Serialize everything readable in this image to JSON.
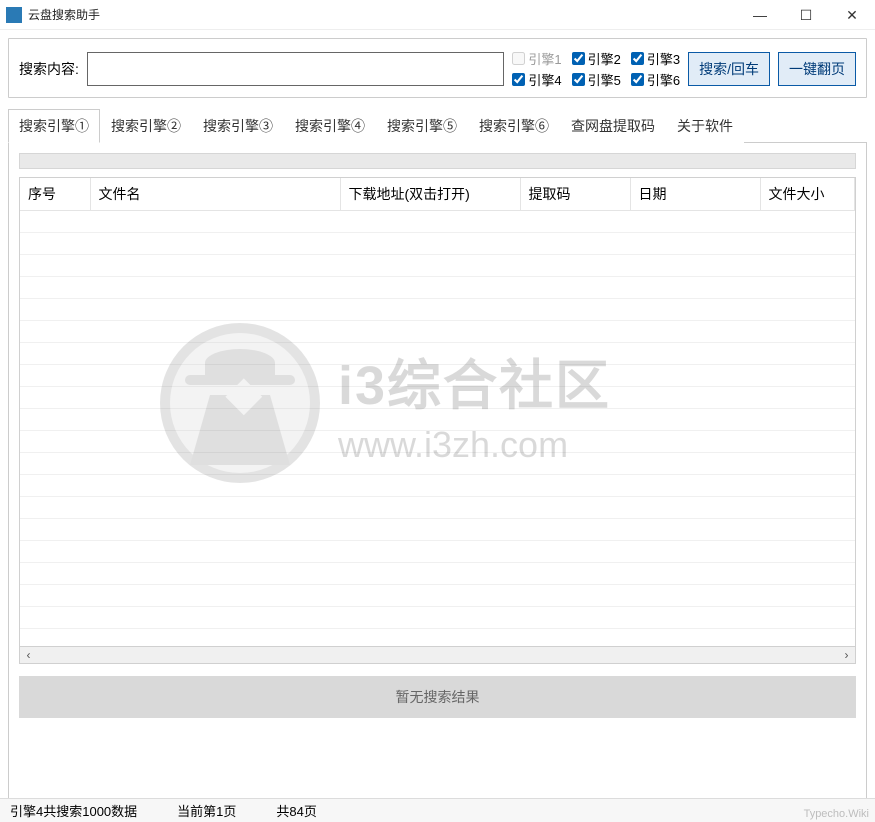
{
  "window": {
    "title": "云盘搜索助手"
  },
  "search": {
    "label": "搜索内容:",
    "value": "",
    "placeholder": ""
  },
  "engines": [
    {
      "label": "引擎1",
      "checked": false,
      "disabled": true
    },
    {
      "label": "引擎2",
      "checked": true,
      "disabled": false
    },
    {
      "label": "引擎3",
      "checked": true,
      "disabled": false
    },
    {
      "label": "引擎4",
      "checked": true,
      "disabled": false
    },
    {
      "label": "引擎5",
      "checked": true,
      "disabled": false
    },
    {
      "label": "引擎6",
      "checked": true,
      "disabled": false
    }
  ],
  "buttons": {
    "search": "搜索/回车",
    "page_flip": "一键翻页"
  },
  "tabs": [
    "搜索引擎①",
    "搜索引擎②",
    "搜索引擎③",
    "搜索引擎④",
    "搜索引擎⑤",
    "搜索引擎⑥",
    "查网盘提取码",
    "关于软件"
  ],
  "active_tab": 0,
  "table": {
    "columns": [
      "序号",
      "文件名",
      "下载地址(双击打开)",
      "提取码",
      "日期",
      "文件大小"
    ]
  },
  "no_result_text": "暂无搜索结果",
  "status": {
    "data_count": "引擎4共搜索1000数据",
    "current_page": "当前第1页",
    "total_pages": "共84页"
  },
  "watermark": {
    "title": "i3综合社区",
    "url": "www.i3zh.com"
  },
  "footer_watermark": "Typecho.Wiki"
}
